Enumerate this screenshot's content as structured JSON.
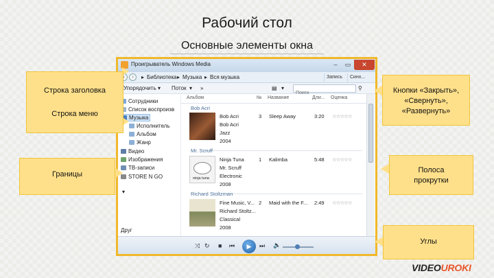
{
  "slide": {
    "title": "Рабочий стол",
    "subtitle": "Основные элементы окна"
  },
  "window": {
    "title": "Проигрыватель Windows Media",
    "controls": {
      "minimize": "–",
      "maximize": "▭",
      "close": "✕"
    },
    "nav": {
      "breadcrumbs": [
        "Библиотека",
        "Музыка",
        "Вся музыка"
      ],
      "tabs": [
        "Запись",
        "Синх..."
      ]
    },
    "toolbar": {
      "organize": "Упорядочить",
      "stream": "Поток",
      "search_placeholder": "Поиск"
    },
    "sidebar": {
      "items": [
        {
          "label": "Сотрудники",
          "icon": "user-icon"
        },
        {
          "label": "Список воспроизв",
          "icon": "playlist-icon"
        },
        {
          "label": "Музыка",
          "icon": "music-icon",
          "selected": true
        },
        {
          "label": "Исполнитель",
          "icon": "artist-icon"
        },
        {
          "label": "Альбом",
          "icon": "album-icon"
        },
        {
          "label": "Жанр",
          "icon": "genre-icon"
        },
        {
          "label": "Видео",
          "icon": "video-icon"
        },
        {
          "label": "Изображения",
          "icon": "image-icon"
        },
        {
          "label": "ТВ-записи",
          "icon": "tv-icon"
        },
        {
          "label": "STORE N GO",
          "icon": "drive-icon"
        }
      ],
      "other": "Друг"
    },
    "columns": [
      "Альбом",
      "№",
      "Название",
      "Дли...",
      "Оценка"
    ],
    "groups": [
      {
        "header": "Bob Acri",
        "album": "Bob Acri",
        "artist": "Bob Acri",
        "genre": "Jazz",
        "year": "2004",
        "num": "3",
        "track": "Sleep Away",
        "length": "3:20",
        "rating": "☆☆☆☆☆",
        "cover_color": "#8a4b2a"
      },
      {
        "header": "Mr. Scruff",
        "album": "Ninja Tuna",
        "artist": "Mr. Scruff",
        "genre": "Electronic",
        "year": "2008",
        "num": "1",
        "track": "Kalimba",
        "length": "5:48",
        "rating": "☆☆☆☆☆",
        "cover_label": "ninja tuna",
        "cover_color": "#f4f4f4"
      },
      {
        "header": "Richard Stoltzman",
        "album": "Fine Music, V...",
        "artist": "Richard Stoltz...",
        "genre": "Classical",
        "year": "2008",
        "num": "2",
        "track": "Maid with the F...",
        "length": "2:49",
        "rating": "☆☆☆☆☆",
        "cover_color": "#b9b18a"
      }
    ],
    "playbar": {
      "shuffle": "⤨",
      "repeat": "↻",
      "stop": "■",
      "prev": "⏮",
      "play": "▶",
      "next": "⏭",
      "mute": "🔈"
    }
  },
  "callouts": {
    "title_bar": "Строка заголовка",
    "menu_bar": "Строка меню",
    "buttons": [
      "Кнопки «Закрыть»,",
      "«Свернуть»,",
      "«Развернуть»"
    ],
    "borders": "Границы",
    "scrollbars": [
      "Полоса",
      "прокрутки"
    ],
    "corners": "Углы"
  },
  "logo": {
    "part1": "VIDEO",
    "part2": "UROKI"
  },
  "colors": {
    "callout_fill": "#ffe08a",
    "window_border": "#f0b82a",
    "close": "#c8462f",
    "logo_accent": "#e8562a"
  }
}
